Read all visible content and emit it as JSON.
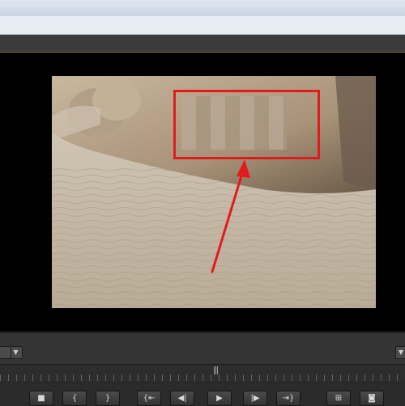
{
  "window": {
    "title": ""
  },
  "monitor": {
    "zoom_value": "",
    "highlight_color": "#e11b1b",
    "annotation": {
      "type": "arrow",
      "color": "#e11b1b"
    }
  },
  "controls": {
    "zoom_dropdown_icon": "chevron-down-icon",
    "right_dropdown_icon": "chevron-down-icon"
  },
  "transport": {
    "buttons": [
      {
        "name": "stop-button",
        "glyph": "■"
      },
      {
        "name": "mark-in-button",
        "glyph": "{"
      },
      {
        "name": "mark-out-button",
        "glyph": "}"
      },
      {
        "name": "go-to-in-button",
        "glyph": "{⇤"
      },
      {
        "name": "step-back-button",
        "glyph": "◀|"
      },
      {
        "name": "play-button",
        "glyph": "▶"
      },
      {
        "name": "step-forward-button",
        "glyph": "|▶"
      },
      {
        "name": "go-to-out-button",
        "glyph": "⇥}"
      },
      {
        "name": "insert-button",
        "glyph": "⊞"
      },
      {
        "name": "camera-button",
        "glyph": "◙"
      }
    ]
  }
}
